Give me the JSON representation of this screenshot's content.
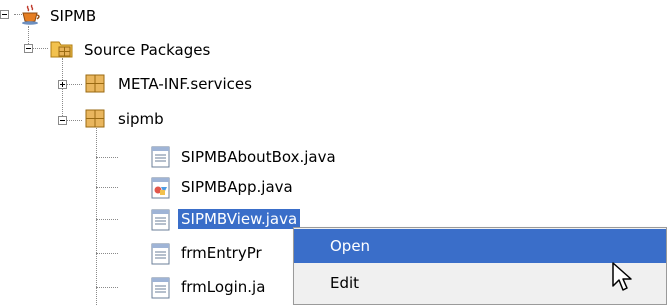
{
  "tree": {
    "project": {
      "label": "SIPMB",
      "icon": "coffee-cup-icon"
    },
    "source_packages": {
      "label": "Source Packages",
      "icon": "folder-package-icon"
    },
    "packages": [
      {
        "label": "META-INF.services",
        "icon": "package-icon",
        "expanded": false
      },
      {
        "label": "sipmb",
        "icon": "package-icon",
        "expanded": true
      }
    ],
    "files": [
      {
        "label": "SIPMBAboutBox.java",
        "icon": "java-form-icon"
      },
      {
        "label": "SIPMBApp.java",
        "icon": "java-app-icon"
      },
      {
        "label": "SIPMBView.java",
        "icon": "java-form-icon",
        "selected": true
      },
      {
        "label": "frmEntryPr",
        "icon": "java-form-icon"
      },
      {
        "label": "frmLogin.ja",
        "icon": "java-form-icon"
      }
    ]
  },
  "context_menu": {
    "items": [
      {
        "label": "Open",
        "highlighted": true
      },
      {
        "label": "Edit",
        "highlighted": false
      }
    ]
  },
  "colors": {
    "selection": "#3a6ec9",
    "menu_bg": "#f0f0f0"
  }
}
